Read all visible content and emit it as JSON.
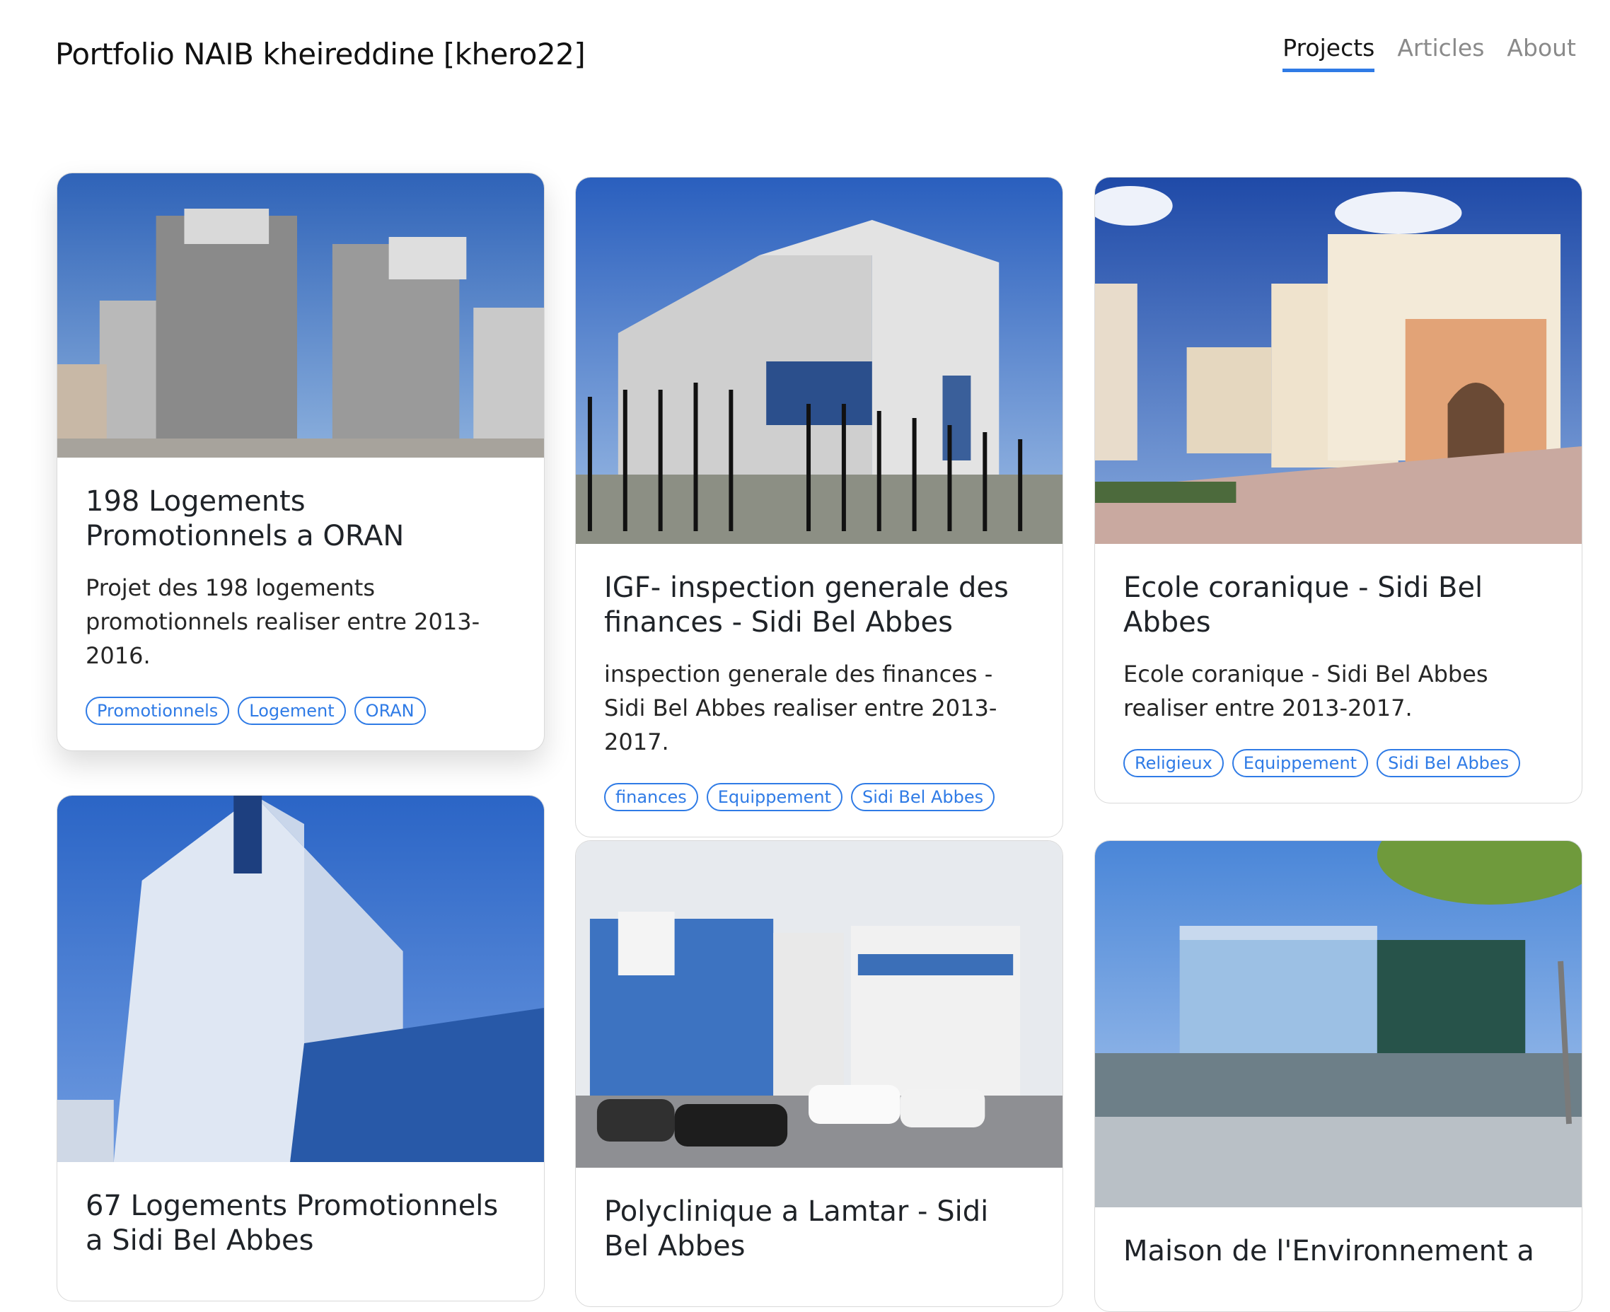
{
  "header": {
    "site_title": "Portfolio NAIB kheireddine [khero22]",
    "nav": [
      {
        "label": "Projects",
        "active": true
      },
      {
        "label": "Articles",
        "active": false
      },
      {
        "label": "About",
        "active": false
      }
    ]
  },
  "projects": [
    {
      "title": "198 Logements Promotionnels a ORAN",
      "description": "Projet des 198 logements promotionnels realiser entre 2013-2016.",
      "tags": [
        "Promotionnels",
        "Logement",
        "ORAN"
      ]
    },
    {
      "title": "IGF- inspection generale des finances - Sidi Bel Abbes",
      "description": "inspection generale des finances - Sidi Bel Abbes realiser entre 2013-2017.",
      "tags": [
        "finances",
        "Equippement",
        "Sidi Bel Abbes"
      ]
    },
    {
      "title": "Ecole coranique - Sidi Bel Abbes",
      "description": "Ecole coranique - Sidi Bel Abbes realiser entre 2013-2017.",
      "tags": [
        "Religieux",
        "Equippement",
        "Sidi Bel Abbes"
      ]
    },
    {
      "title": "67 Logements Promotionnels a Sidi Bel Abbes",
      "description": "",
      "tags": []
    },
    {
      "title": "Polyclinique a Lamtar - Sidi Bel Abbes",
      "description": "",
      "tags": []
    },
    {
      "title": "Maison de l'Environnement a",
      "description": "",
      "tags": []
    }
  ],
  "colors": {
    "accent": "#2f7be6",
    "title_text": "#111111",
    "muted_nav": "#8a8a8a"
  }
}
